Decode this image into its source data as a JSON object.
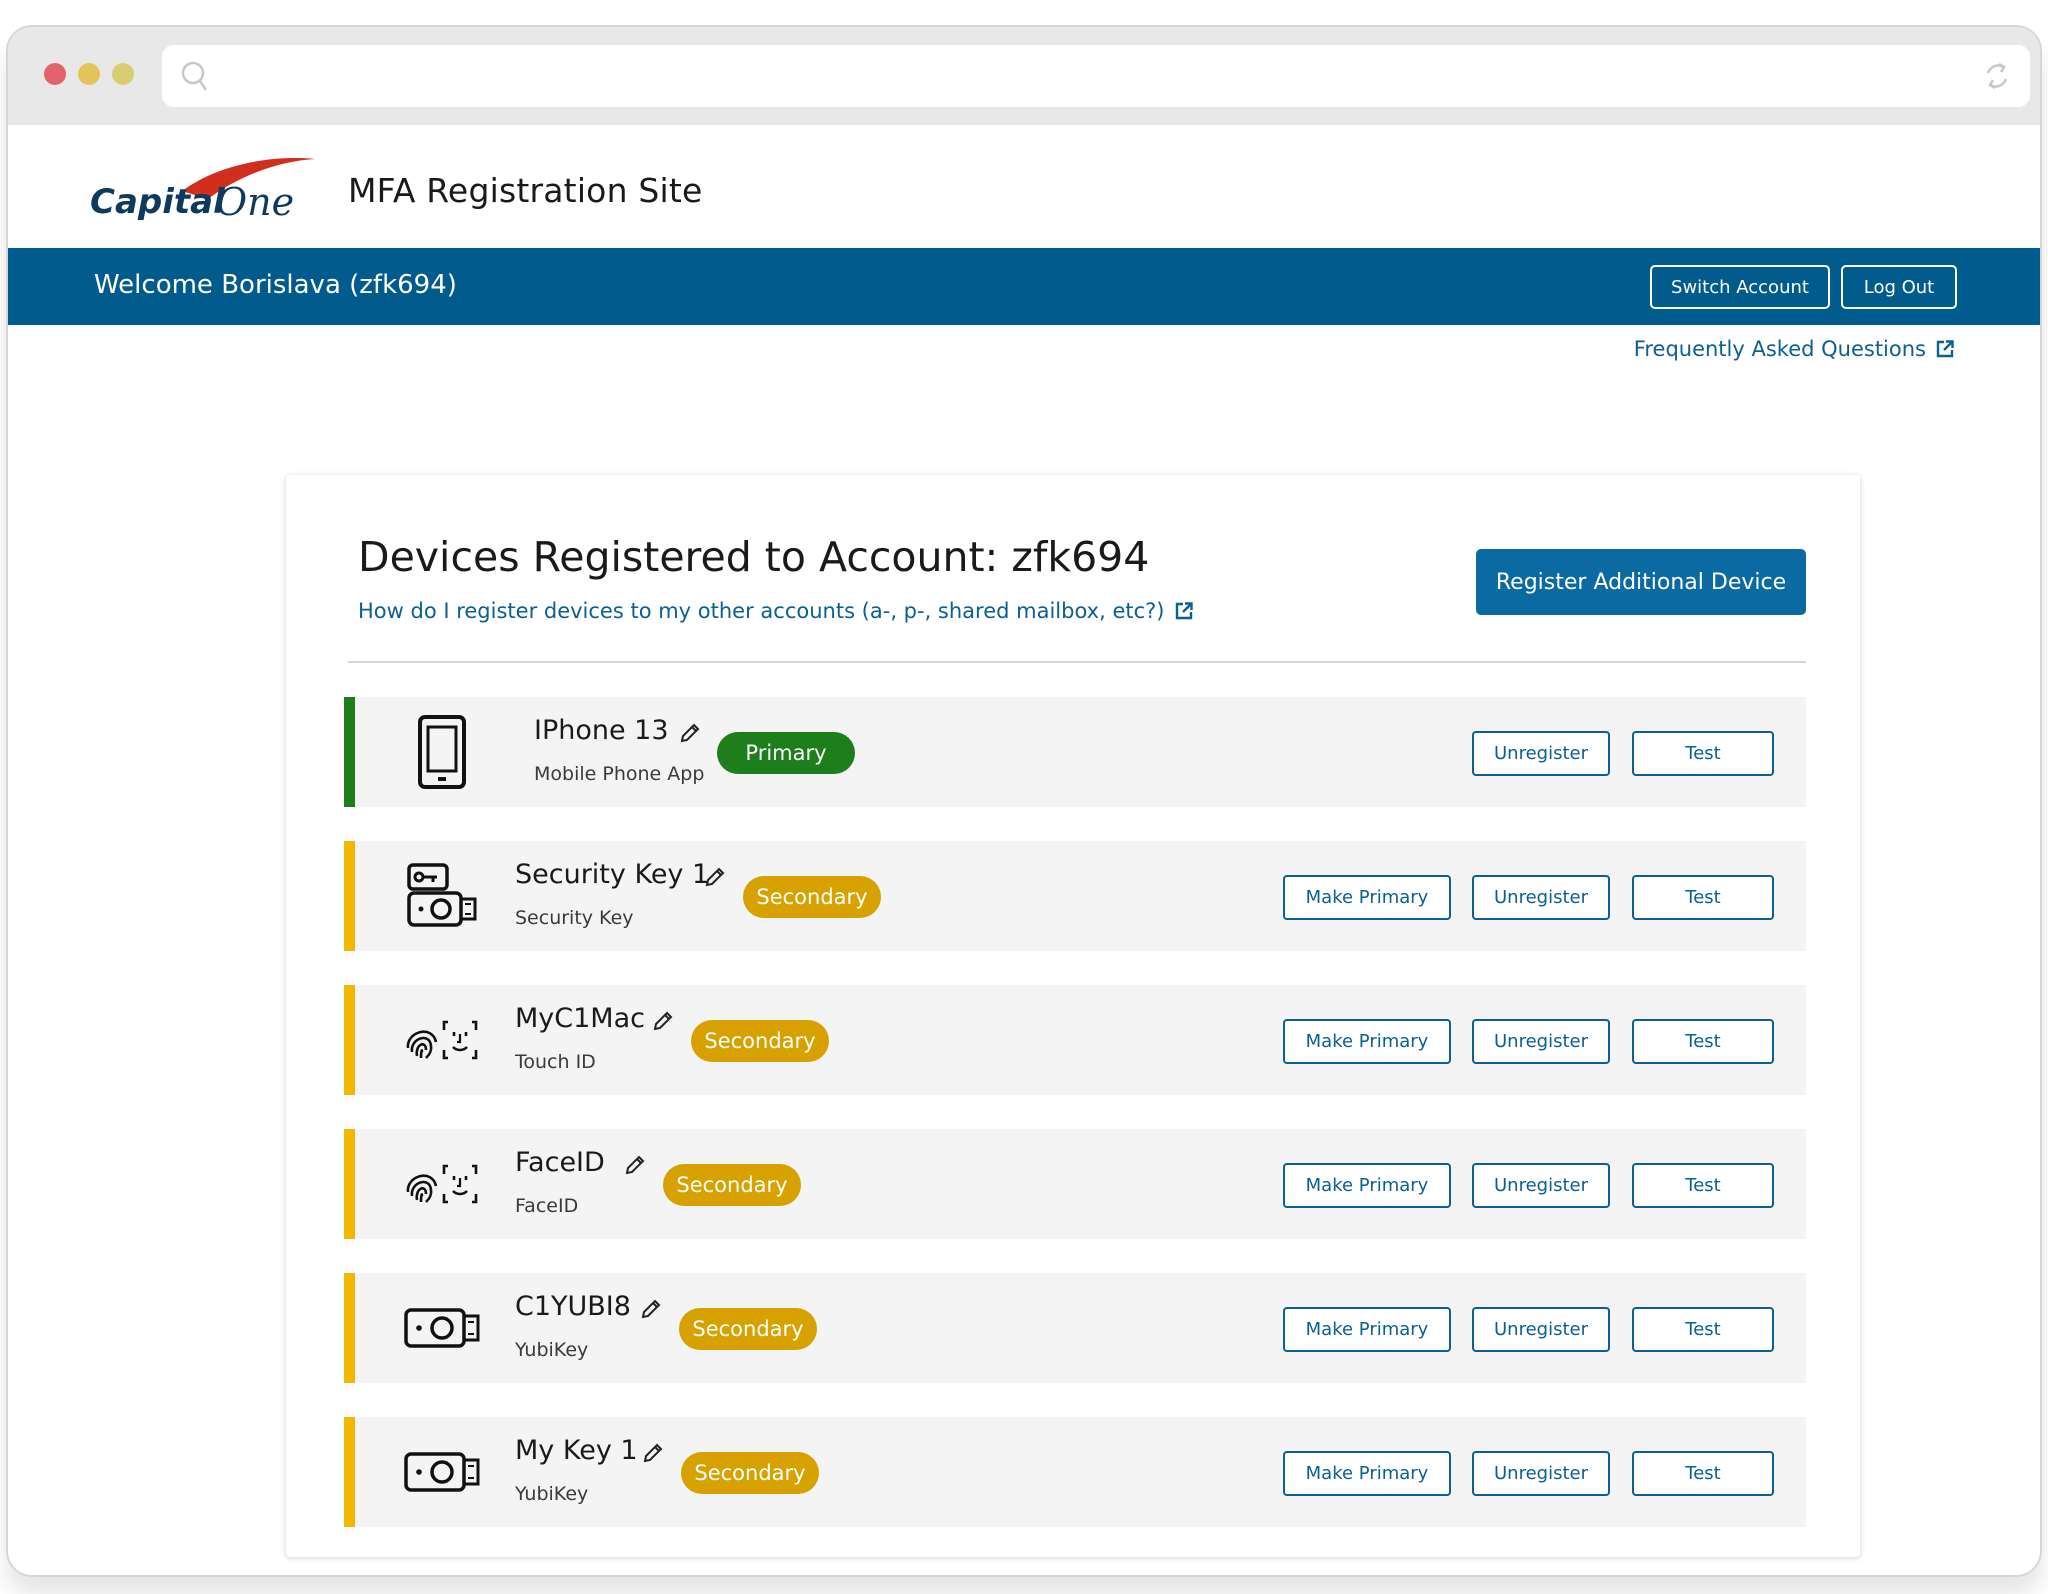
{
  "header": {
    "logo_text": "Capital One",
    "site_title": "MFA Registration Site"
  },
  "nav": {
    "welcome": "Welcome Borislava (zfk694)",
    "switch_account": "Switch Account",
    "log_out": "Log Out"
  },
  "faq_link": "Frequently Asked Questions",
  "card": {
    "title": "Devices Registered to Account: zfk694",
    "subtitle_link": "How do I register devices to my other accounts (a-, p-, shared mailbox, etc?)",
    "register_button": "Register Additional Device"
  },
  "buttons": {
    "make_primary": "Make Primary",
    "unregister": "Unregister",
    "test": "Test"
  },
  "devices": [
    {
      "name": "IPhone 13",
      "type": "Mobile Phone App",
      "badge": "Primary",
      "icon": "smartphone-icon"
    },
    {
      "name": "Security Key 1",
      "type": "Security Key",
      "badge": "Secondary",
      "icon": "security-key-icon"
    },
    {
      "name": "MyC1Mac",
      "type": "Touch ID",
      "badge": "Secondary",
      "icon": "biometric-icon"
    },
    {
      "name": "FaceID",
      "type": "FaceID",
      "badge": "Secondary",
      "icon": "biometric-icon"
    },
    {
      "name": "C1YUBI8",
      "type": "YubiKey",
      "badge": "Secondary",
      "icon": "yubikey-icon"
    },
    {
      "name": "My Key 1",
      "type": "YubiKey",
      "badge": "Secondary",
      "icon": "yubikey-icon"
    }
  ],
  "colors": {
    "brand_blue": "#015b8c",
    "link_blue": "#0a5f93",
    "primary_green": "#1e7e1b",
    "secondary_gold": "#d7a200"
  }
}
